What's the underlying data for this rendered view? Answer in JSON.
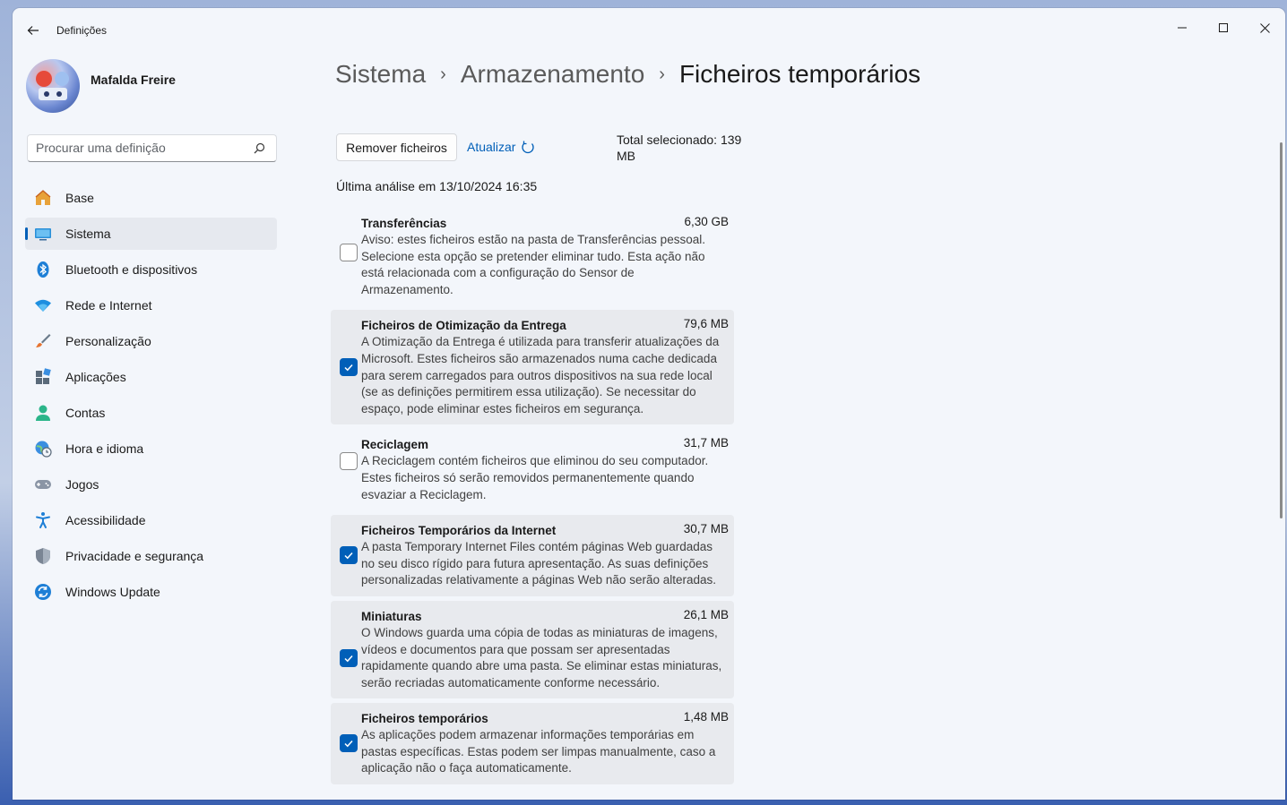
{
  "window": {
    "app_title": "Definições"
  },
  "profile": {
    "name": "Mafalda Freire"
  },
  "search": {
    "placeholder": "Procurar uma definição"
  },
  "sidebar": {
    "items": [
      {
        "label": "Base",
        "icon": "home-icon",
        "active": false
      },
      {
        "label": "Sistema",
        "icon": "system-icon",
        "active": true
      },
      {
        "label": "Bluetooth e dispositivos",
        "icon": "bluetooth-icon",
        "active": false
      },
      {
        "label": "Rede e Internet",
        "icon": "wifi-icon",
        "active": false
      },
      {
        "label": "Personalização",
        "icon": "brush-icon",
        "active": false
      },
      {
        "label": "Aplicações",
        "icon": "apps-icon",
        "active": false
      },
      {
        "label": "Contas",
        "icon": "account-icon",
        "active": false
      },
      {
        "label": "Hora e idioma",
        "icon": "time-language-icon",
        "active": false
      },
      {
        "label": "Jogos",
        "icon": "gamepad-icon",
        "active": false
      },
      {
        "label": "Acessibilidade",
        "icon": "accessibility-icon",
        "active": false
      },
      {
        "label": "Privacidade e segurança",
        "icon": "shield-icon",
        "active": false
      },
      {
        "label": "Windows Update",
        "icon": "update-icon",
        "active": false
      }
    ]
  },
  "breadcrumb": {
    "level1": "Sistema",
    "level2": "Armazenamento",
    "current": "Ficheiros temporários"
  },
  "actions": {
    "remove_label": "Remover ficheiros",
    "refresh_label": "Atualizar",
    "total_selected": "Total selecionado: 139 MB"
  },
  "last_scan": "Última análise em 13/10/2024 16:35",
  "items": [
    {
      "title": "Transferências",
      "size": "6,30 GB",
      "checked": false,
      "desc": "Aviso: estes ficheiros estão na pasta de Transferências pessoal. Selecione esta opção se pretender eliminar tudo. Esta ação não está relacionada com a configuração do Sensor de Armazenamento."
    },
    {
      "title": "Ficheiros de Otimização da Entrega",
      "size": "79,6 MB",
      "checked": true,
      "desc": "A Otimização da Entrega é utilizada para transferir atualizações da Microsoft. Estes ficheiros são armazenados numa cache dedicada para serem carregados para outros dispositivos na sua rede local (se as definições permitirem essa utilização). Se necessitar do espaço, pode eliminar estes ficheiros em segurança."
    },
    {
      "title": "Reciclagem",
      "size": "31,7 MB",
      "checked": false,
      "desc": "A Reciclagem contém ficheiros que eliminou do seu computador. Estes ficheiros só serão removidos permanentemente quando esvaziar a Reciclagem."
    },
    {
      "title": "Ficheiros Temporários da Internet",
      "size": "30,7 MB",
      "checked": true,
      "desc": "A pasta Temporary Internet Files contém páginas Web guardadas no seu disco rígido para futura apresentação. As suas definições personalizadas relativamente a páginas Web não serão alteradas."
    },
    {
      "title": "Miniaturas",
      "size": "26,1 MB",
      "checked": true,
      "desc": "O Windows guarda uma cópia de todas as miniaturas de imagens, vídeos e documentos para que possam ser apresentadas rapidamente quando abre uma pasta. Se eliminar estas miniaturas, serão recriadas automaticamente conforme necessário."
    },
    {
      "title": "Ficheiros temporários",
      "size": "1,48 MB",
      "checked": true,
      "desc": "As aplicações podem armazenar informações temporárias em pastas específicas. Estas podem ser limpas manualmente, caso a aplicação não o faça automaticamente."
    }
  ],
  "colors": {
    "accent": "#005fb8",
    "window_bg": "#f3f6fb",
    "selected_row": "#e8eaee"
  }
}
